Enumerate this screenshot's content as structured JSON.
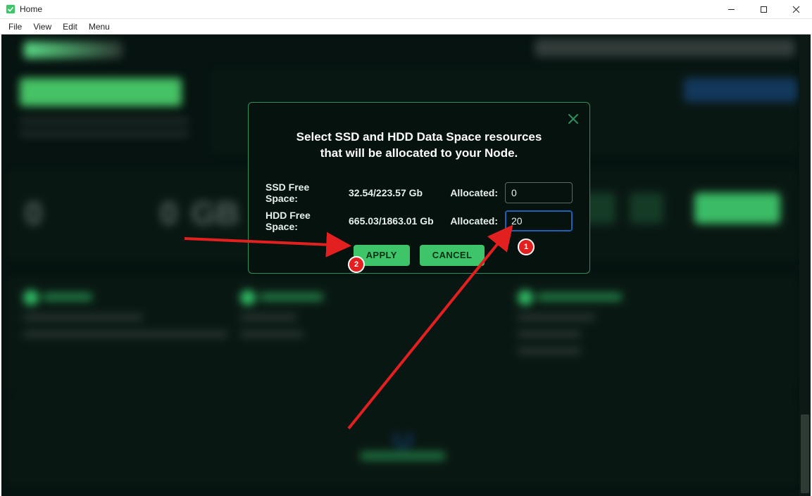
{
  "window": {
    "title": "Home",
    "menus": [
      "File",
      "View",
      "Edit",
      "Menu"
    ]
  },
  "modal": {
    "heading": "Select SSD and HDD Data Space resources that will be allocated to your Node.",
    "ssd_label": "SSD Free Space:",
    "ssd_value": "32.54/223.57 Gb",
    "hdd_label": "HDD Free Space:",
    "hdd_value": "665.03/1863.01 Gb",
    "allocated_label": "Allocated:",
    "ssd_allocated": "0",
    "hdd_allocated": "20",
    "apply": "APPLY",
    "cancel": "CANCEL"
  },
  "annotation": {
    "badge1": "1",
    "badge2": "2"
  }
}
